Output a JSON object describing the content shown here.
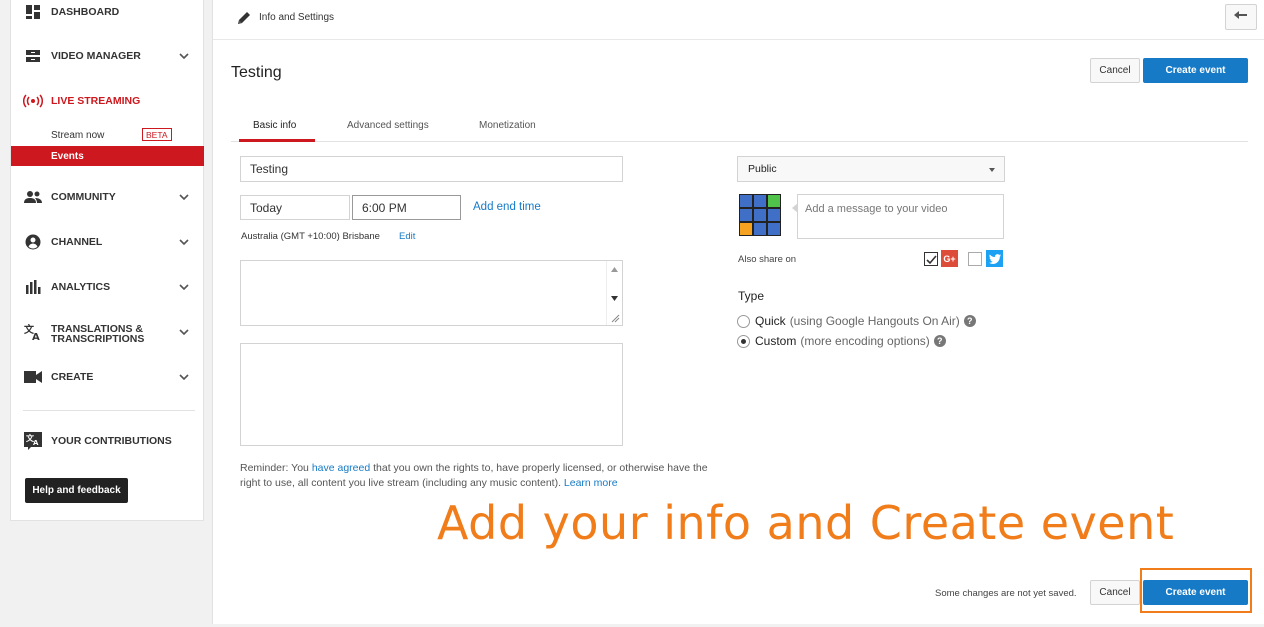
{
  "sidebar": {
    "items": [
      {
        "label": "DASHBOARD",
        "icon": "dashboard-icon"
      },
      {
        "label": "VIDEO MANAGER",
        "icon": "video-manager-icon"
      },
      {
        "label": "LIVE STREAMING",
        "icon": "live-streaming-icon"
      },
      {
        "label": "COMMUNITY",
        "icon": "community-icon"
      },
      {
        "label": "CHANNEL",
        "icon": "channel-icon"
      },
      {
        "label": "ANALYTICS",
        "icon": "analytics-icon"
      },
      {
        "label": "TRANSLATIONS &",
        "label2": "TRANSCRIPTIONS",
        "icon": "translate-icon"
      },
      {
        "label": "CREATE",
        "icon": "camera-icon"
      },
      {
        "label": "YOUR CONTRIBUTIONS",
        "icon": "translate-icon"
      }
    ],
    "sub": {
      "stream_now": "Stream now",
      "beta": "BETA",
      "events": "Events"
    },
    "help_button": "Help and feedback"
  },
  "topbar": {
    "title": "Info and Settings"
  },
  "page": {
    "title": "Testing",
    "cancel": "Cancel",
    "create": "Create event",
    "tabs": [
      "Basic info",
      "Advanced settings",
      "Monetization"
    ]
  },
  "form": {
    "title_value": "Testing",
    "date_value": "Today",
    "time_value": "6:00 PM",
    "add_end_time": "Add end time",
    "timezone": "Australia (GMT +10:00) Brisbane",
    "edit": "Edit",
    "reminder_pre": "Reminder: You ",
    "reminder_link": "have agreed",
    "reminder_post": " that you own the rights to, have properly licensed, or otherwise have the right to use, all content you live stream (including any music content). ",
    "learn_more": "Learn more"
  },
  "right": {
    "privacy": "Public",
    "message_placeholder": "Add a message to your video",
    "also_share": "Also share on",
    "gplus": "G+",
    "type_label": "Type",
    "quick": "Quick",
    "quick_note": "(using Google Hangouts On Air)",
    "custom": "Custom",
    "custom_note": "(more encoding options)",
    "help": "?"
  },
  "footer": {
    "unsaved": "Some changes are not yet saved.",
    "cancel": "Cancel",
    "create": "Create event"
  },
  "annotation": "Add your info and Create event",
  "colors": {
    "accent_red": "#cc181e",
    "primary_blue": "#167ac6",
    "annotation_orange": "#f07c1a"
  }
}
